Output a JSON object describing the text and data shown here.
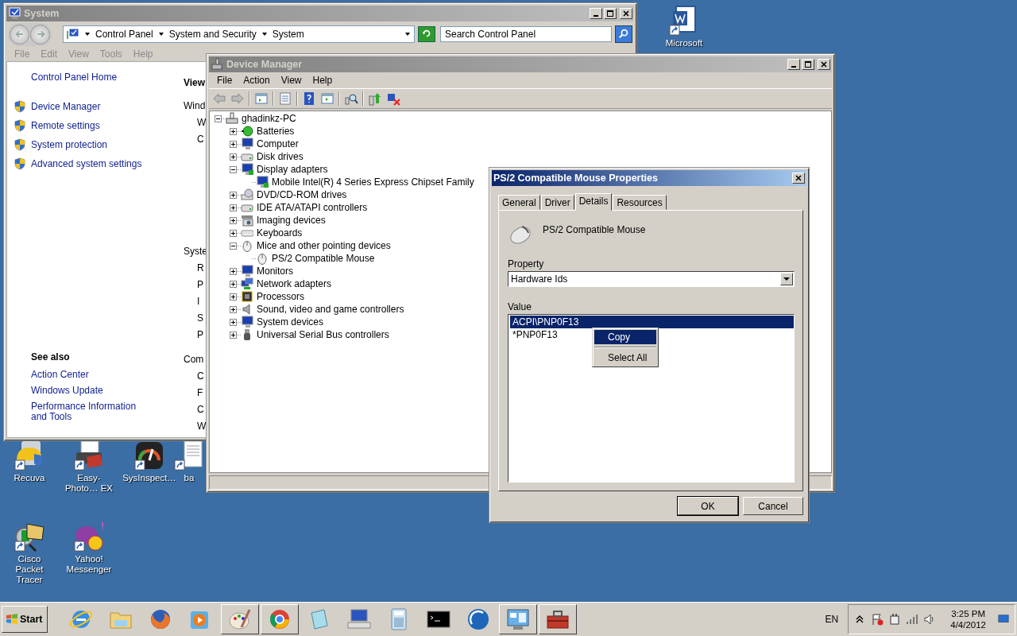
{
  "desktop": {
    "icons": [
      {
        "label": "Microsoft",
        "kind": "word"
      },
      {
        "label": "Recuva",
        "kind": "helmet"
      },
      {
        "label": "Easy-Photo… EX",
        "kind": "printer"
      },
      {
        "label": "SysInspect…",
        "kind": "gauge"
      },
      {
        "label": "ba",
        "kind": "page"
      },
      {
        "label": "Cisco Packet Tracer",
        "kind": "envelope"
      },
      {
        "label": "Yahoo! Messenger",
        "kind": "bubble"
      }
    ]
  },
  "system_window": {
    "title": "System",
    "breadcrumb": [
      "Control Panel",
      "System and Security",
      "System"
    ],
    "search": {
      "placeholder": "Search Control Panel"
    },
    "menu": [
      {
        "label": "File",
        "disabled": true
      },
      {
        "label": "Edit",
        "disabled": true
      },
      {
        "label": "View",
        "disabled": true
      },
      {
        "label": "Tools",
        "disabled": true
      },
      {
        "label": "Help",
        "disabled": true
      }
    ],
    "home_link": "Control Panel Home",
    "tasks": [
      "Device Manager",
      "Remote settings",
      "System protection",
      "Advanced system settings"
    ],
    "see_also_title": "See also",
    "see_also": [
      "Action Center",
      "Windows Update",
      "Performance Information and Tools"
    ],
    "content_sections": [
      {
        "heading": "View"
      },
      {
        "heading": "Wind",
        "items": [
          "W",
          "C"
        ]
      },
      {
        "heading": "Syste",
        "items": [
          "R",
          "P",
          "I",
          "S",
          "P"
        ]
      },
      {
        "heading": "Com",
        "items": [
          "C",
          "F",
          "C",
          "W"
        ]
      }
    ]
  },
  "device_manager": {
    "title": "Device Manager",
    "menu": [
      "File",
      "Action",
      "View",
      "Help"
    ],
    "tree": {
      "label": "ghadinkz-PC",
      "kind": "pc",
      "expanded": true,
      "children": [
        {
          "label": "Batteries",
          "kind": "battery",
          "expanded": false
        },
        {
          "label": "Computer",
          "kind": "computer",
          "expanded": false
        },
        {
          "label": "Disk drives",
          "kind": "drive",
          "expanded": false
        },
        {
          "label": "Display adapters",
          "kind": "display",
          "expanded": true,
          "children": [
            {
              "label": "Mobile Intel(R) 4 Series Express Chipset Family",
              "kind": "display"
            }
          ]
        },
        {
          "label": "DVD/CD-ROM drives",
          "kind": "disc",
          "expanded": false
        },
        {
          "label": "IDE ATA/ATAPI controllers",
          "kind": "drive",
          "expanded": false
        },
        {
          "label": "Imaging devices",
          "kind": "camera",
          "expanded": false
        },
        {
          "label": "Keyboards",
          "kind": "keyboard",
          "expanded": false
        },
        {
          "label": "Mice and other pointing devices",
          "kind": "mouse",
          "expanded": true,
          "children": [
            {
              "label": "PS/2 Compatible Mouse",
              "kind": "mouse"
            }
          ]
        },
        {
          "label": "Monitors",
          "kind": "monitor",
          "expanded": false
        },
        {
          "label": "Network adapters",
          "kind": "network",
          "expanded": false
        },
        {
          "label": "Processors",
          "kind": "chip",
          "expanded": false
        },
        {
          "label": "Sound, video and game controllers",
          "kind": "speaker",
          "expanded": false
        },
        {
          "label": "System devices",
          "kind": "computer",
          "expanded": false
        },
        {
          "label": "Universal Serial Bus controllers",
          "kind": "usb",
          "expanded": false
        }
      ]
    }
  },
  "properties_dialog": {
    "title": "PS/2 Compatible Mouse Properties",
    "tabs": [
      {
        "label": "General",
        "selected": false
      },
      {
        "label": "Driver",
        "selected": false
      },
      {
        "label": "Details",
        "selected": true
      },
      {
        "label": "Resources",
        "selected": false
      }
    ],
    "device_name": "PS/2 Compatible Mouse",
    "property_label": "Property",
    "property_value": "Hardware Ids",
    "value_label": "Value",
    "values": [
      {
        "text": "ACPI\\PNP0F13",
        "selected": true
      },
      {
        "text": "*PNP0F13",
        "selected": false
      }
    ],
    "context_menu": [
      {
        "label": "Copy",
        "selected": true
      },
      {
        "label": "Select All",
        "selected": false
      }
    ],
    "buttons": [
      {
        "label": "OK",
        "default": true
      },
      {
        "label": "Cancel",
        "default": false
      }
    ]
  },
  "taskbar": {
    "start": "Start",
    "apps": [
      {
        "kind": "ie",
        "running": false
      },
      {
        "kind": "folder",
        "running": false
      },
      {
        "kind": "firefox",
        "running": false
      },
      {
        "kind": "media",
        "running": false
      },
      {
        "kind": "paint",
        "running": true
      },
      {
        "kind": "chrome",
        "running": true
      },
      {
        "kind": "notepad",
        "running": false
      },
      {
        "kind": "remote",
        "running": false
      },
      {
        "kind": "calculator",
        "running": false
      },
      {
        "kind": "console",
        "running": false
      },
      {
        "kind": "dish",
        "running": false
      },
      {
        "kind": "panel",
        "running": true
      },
      {
        "kind": "toolbox",
        "running": true
      }
    ],
    "language": "EN",
    "time": "3:25 PM",
    "date": "4/4/2012"
  }
}
